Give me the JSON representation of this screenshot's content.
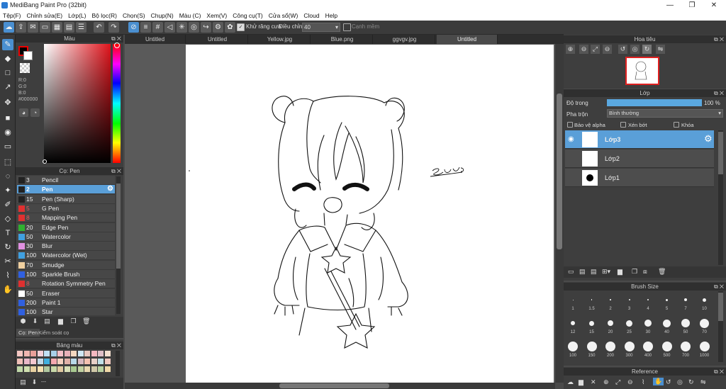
{
  "window": {
    "title": "MediBang Paint Pro (32bit)"
  },
  "menu": [
    "Tệp(F)",
    "Chỉnh sửa(E)",
    "Lớp(L)",
    "Bộ lọc(R)",
    "Chọn(S)",
    "Chụp(N)",
    "Màu (C)",
    "Xem(V)",
    "Công cụ(T)",
    "Cửa sổ(W)",
    "Cloud",
    "Help"
  ],
  "toolbar": {
    "antialias_label": "Khử răng cưa",
    "adjust_label": "Điều chỉnh",
    "adjust_value": "40",
    "smooth_label": "Cạnh mềm"
  },
  "tabs": [
    "Untitled",
    "Untitled",
    "Yellow.jpg",
    "Blue.png",
    "ggvgv.jpg",
    "Untitled"
  ],
  "color": {
    "title": "Màu",
    "r": "R:0",
    "g": "G:0",
    "b": "B:0",
    "hex": "#000000"
  },
  "brush": {
    "title": "Cọ: Pen",
    "items": [
      {
        "size": "3",
        "name": "Pencil",
        "color": "#222222"
      },
      {
        "size": "2",
        "name": "Pen",
        "color": "#222222",
        "selected": true
      },
      {
        "size": "15",
        "name": "Pen (Sharp)",
        "color": "#222222"
      },
      {
        "size": "5",
        "name": "G Pen",
        "color": "#e03030"
      },
      {
        "size": "8",
        "name": "Mapping Pen",
        "color": "#e03030"
      },
      {
        "size": "20",
        "name": "Edge Pen",
        "color": "#30b030"
      },
      {
        "size": "50",
        "name": "Watercolor",
        "color": "#40a0e0"
      },
      {
        "size": "30",
        "name": "Blur",
        "color": "#e090e0"
      },
      {
        "size": "100",
        "name": "Watercolor (Wet)",
        "color": "#40a0e0"
      },
      {
        "size": "70",
        "name": "Smudge",
        "color": "#f0d0a0"
      },
      {
        "size": "100",
        "name": "Sparkle Brush",
        "color": "#3060e0"
      },
      {
        "size": "8",
        "name": "Rotation Symmetry Pen",
        "color": "#e03030"
      },
      {
        "size": "50",
        "name": "Eraser",
        "color": "#ffffff"
      },
      {
        "size": "200",
        "name": "Paint 1",
        "color": "#3060e0"
      },
      {
        "size": "100",
        "name": "Star",
        "color": "#3060e0"
      }
    ],
    "bottom_tabs": [
      "Cọ: Pen",
      "Kiểm soát cọ"
    ]
  },
  "palette": {
    "title": "Bảng màu",
    "footer": "---"
  },
  "navigator": {
    "title": "Hoa tiêu"
  },
  "layer": {
    "title": "Lớp",
    "opacity_label": "Độ trong",
    "opacity_value": "100 %",
    "opacity": 100,
    "blend_label": "Pha trộn",
    "blend_value": "Bình thường",
    "protect_alpha": "Bảo vệ alpha",
    "clipping": "Xén bớt",
    "lock": "Khóa",
    "layers": [
      "Lớp3",
      "Lớp2",
      "Lớp1"
    ]
  },
  "brush_size": {
    "title": "Brush Size",
    "sizes": [
      "1",
      "1.5",
      "2",
      "3",
      "4",
      "5",
      "7",
      "10",
      "12",
      "15",
      "20",
      "25",
      "30",
      "40",
      "50",
      "70",
      "100",
      "150",
      "200",
      "300",
      "400",
      "500",
      "700",
      "1000"
    ]
  },
  "reference": {
    "title": "Reference"
  },
  "canvas": {
    "signature": "Suus"
  },
  "colors": {
    "accent": "#4a8fd0",
    "selection": "#5a9fd8",
    "panel": "#3e3e3e"
  }
}
